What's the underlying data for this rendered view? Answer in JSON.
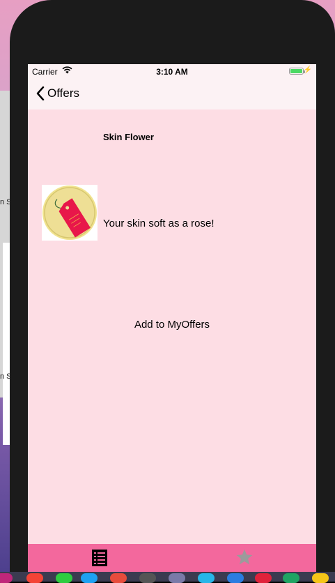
{
  "status": {
    "carrier": "Carrier",
    "time": "3:10 AM"
  },
  "nav": {
    "back_label": "Offers"
  },
  "offer": {
    "name": "Skin Flower",
    "description": "Your skin soft as a rose!",
    "icon": "price-tag-icon"
  },
  "actions": {
    "add_label": "Add to MyOffers"
  },
  "tabbar": {
    "tabs": [
      {
        "icon": "list-icon"
      },
      {
        "icon": "star-icon"
      }
    ]
  },
  "desktop": {
    "partial_text_1": "n S",
    "partial_text_2": "n S"
  },
  "colors": {
    "background": "#fddde4",
    "tabbar": "#f3689d",
    "navbar": "#fcf2f4",
    "tag": "#e8174a"
  }
}
